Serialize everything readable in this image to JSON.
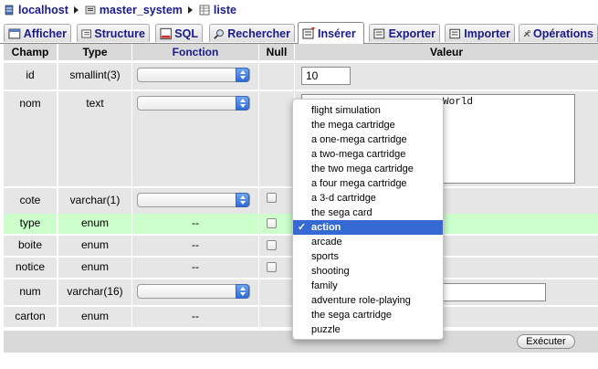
{
  "breadcrumb": [
    {
      "label": "localhost",
      "icon": "server-icon"
    },
    {
      "label": "master_system",
      "icon": "database-icon"
    },
    {
      "label": "liste",
      "icon": "table-icon"
    }
  ],
  "tabs": [
    {
      "label": "Afficher",
      "icon": "browse-icon",
      "active": false
    },
    {
      "label": "Structure",
      "icon": "structure-icon",
      "active": false
    },
    {
      "label": "SQL",
      "icon": "sql-icon",
      "active": false
    },
    {
      "label": "Rechercher",
      "icon": "search-icon",
      "active": false
    },
    {
      "label": "Insérer",
      "icon": "insert-icon",
      "active": true
    },
    {
      "label": "Exporter",
      "icon": "export-icon",
      "active": false
    },
    {
      "label": "Importer",
      "icon": "import-icon",
      "active": false
    },
    {
      "label": "Opérations",
      "icon": "operations-icon",
      "active": false
    }
  ],
  "table": {
    "headers": {
      "field": "Champ",
      "type": "Type",
      "function": "Fonction",
      "null": "Null",
      "value": "Valeur"
    },
    "rows": [
      {
        "field": "id",
        "type": "smallint(3)",
        "function": "",
        "null": "",
        "value": "10"
      },
      {
        "field": "nom",
        "type": "text",
        "function": "",
        "null": "",
        "value": "World"
      },
      {
        "field": "cote",
        "type": "varchar(1)",
        "function": "",
        "null": "",
        "value": ""
      },
      {
        "field": "type",
        "type": "enum",
        "function": "--",
        "null": "",
        "value": "action"
      },
      {
        "field": "boite",
        "type": "enum",
        "function": "--",
        "null": "",
        "value": ""
      },
      {
        "field": "notice",
        "type": "enum",
        "function": "--",
        "null": "",
        "value": ""
      },
      {
        "field": "num",
        "type": "varchar(16)",
        "function": "",
        "null": "",
        "value": ""
      },
      {
        "field": "carton",
        "type": "enum",
        "function": "--",
        "null": "",
        "value": ""
      }
    ]
  },
  "dropdown": {
    "options": [
      "flight simulation",
      "the mega cartridge",
      "a one-mega cartridge",
      "a two-mega cartridge",
      "the two mega cartridge",
      "a four mega cartridge",
      "a 3-d cartridge",
      "the sega card",
      "action",
      "arcade",
      "sports",
      "shooting",
      "family",
      "adventure role-playing",
      "the sega cartridge",
      "puzzle"
    ],
    "selected": "action",
    "check_glyph": "✓"
  },
  "execute_label": "Exécuter",
  "colors": {
    "link": "#1a1a8a",
    "header_bg": "#d9d9d9",
    "row_bg": "#e6e6e6",
    "highlight_row": "#ccffcc",
    "selection": "#3569d4"
  }
}
